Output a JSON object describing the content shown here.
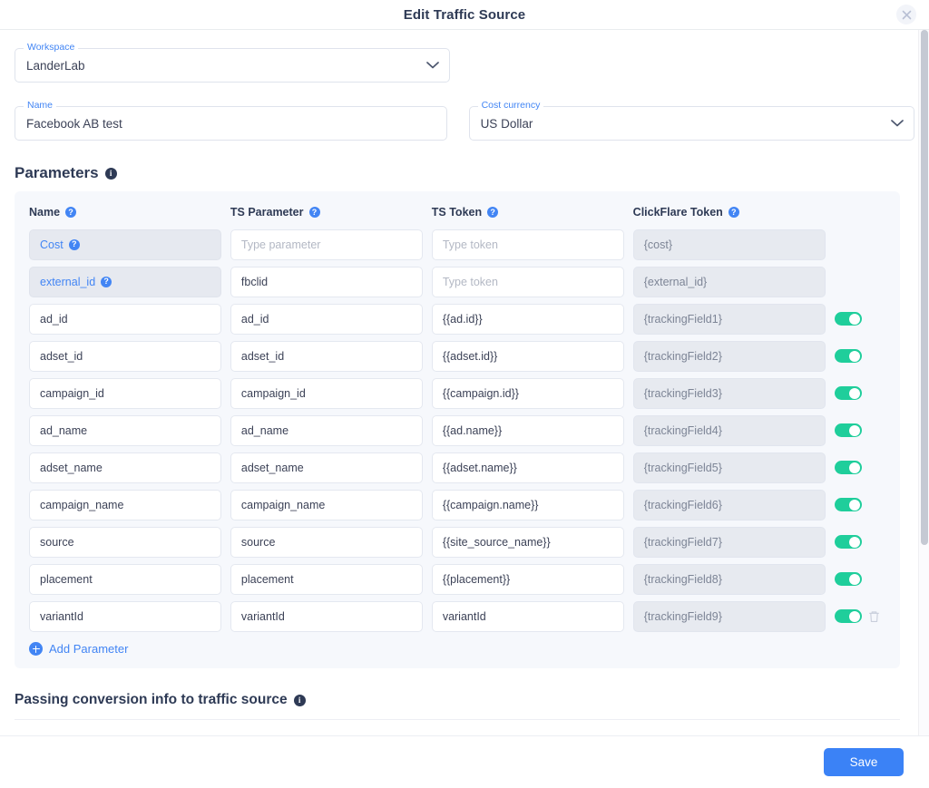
{
  "header": {
    "title": "Edit Traffic Source",
    "close_icon": "close-icon"
  },
  "form": {
    "workspace": {
      "label": "Workspace",
      "value": "LanderLab"
    },
    "name": {
      "label": "Name",
      "value": "Facebook AB test"
    },
    "cost_currency": {
      "label": "Cost currency",
      "value": "US Dollar"
    }
  },
  "parameters_section": {
    "title": "Parameters",
    "info_icon": "info-icon",
    "columns": [
      {
        "label": "Name",
        "help_icon": "help-icon"
      },
      {
        "label": "TS Parameter",
        "help_icon": "help-icon"
      },
      {
        "label": "TS Token",
        "help_icon": "help-icon"
      },
      {
        "label": "ClickFlare Token",
        "help_icon": "help-icon"
      }
    ],
    "placeholders": {
      "parameter": "Type parameter",
      "token": "Type token"
    },
    "rows": [
      {
        "name": "Cost",
        "name_locked": true,
        "name_help": true,
        "ts_parameter": "",
        "ts_parameter_placeholder": "Type parameter",
        "ts_token": "",
        "ts_token_placeholder": "Type token",
        "clickflare_token": "{cost}",
        "cf_disabled": true,
        "toggle": false,
        "toggle_on": false,
        "delete": false
      },
      {
        "name": "external_id",
        "name_locked": true,
        "name_help": true,
        "ts_parameter": "fbclid",
        "ts_parameter_placeholder": "",
        "ts_token": "",
        "ts_token_placeholder": "Type token",
        "clickflare_token": "{external_id}",
        "cf_disabled": true,
        "toggle": false,
        "toggle_on": false,
        "delete": false
      },
      {
        "name": "ad_id",
        "name_locked": false,
        "name_help": false,
        "ts_parameter": "ad_id",
        "ts_parameter_placeholder": "",
        "ts_token": "{{ad.id}}",
        "ts_token_placeholder": "",
        "clickflare_token": "{trackingField1}",
        "cf_disabled": true,
        "toggle": true,
        "toggle_on": true,
        "delete": false
      },
      {
        "name": "adset_id",
        "name_locked": false,
        "name_help": false,
        "ts_parameter": "adset_id",
        "ts_parameter_placeholder": "",
        "ts_token": "{{adset.id}}",
        "ts_token_placeholder": "",
        "clickflare_token": "{trackingField2}",
        "cf_disabled": true,
        "toggle": true,
        "toggle_on": true,
        "delete": false
      },
      {
        "name": "campaign_id",
        "name_locked": false,
        "name_help": false,
        "ts_parameter": "campaign_id",
        "ts_parameter_placeholder": "",
        "ts_token": "{{campaign.id}}",
        "ts_token_placeholder": "",
        "clickflare_token": "{trackingField3}",
        "cf_disabled": true,
        "toggle": true,
        "toggle_on": true,
        "delete": false
      },
      {
        "name": "ad_name",
        "name_locked": false,
        "name_help": false,
        "ts_parameter": "ad_name",
        "ts_parameter_placeholder": "",
        "ts_token": "{{ad.name}}",
        "ts_token_placeholder": "",
        "clickflare_token": "{trackingField4}",
        "cf_disabled": true,
        "toggle": true,
        "toggle_on": true,
        "delete": false
      },
      {
        "name": "adset_name",
        "name_locked": false,
        "name_help": false,
        "ts_parameter": "adset_name",
        "ts_parameter_placeholder": "",
        "ts_token": "{{adset.name}}",
        "ts_token_placeholder": "",
        "clickflare_token": "{trackingField5}",
        "cf_disabled": true,
        "toggle": true,
        "toggle_on": true,
        "delete": false
      },
      {
        "name": "campaign_name",
        "name_locked": false,
        "name_help": false,
        "ts_parameter": "campaign_name",
        "ts_parameter_placeholder": "",
        "ts_token": "{{campaign.name}}",
        "ts_token_placeholder": "",
        "clickflare_token": "{trackingField6}",
        "cf_disabled": true,
        "toggle": true,
        "toggle_on": true,
        "delete": false
      },
      {
        "name": "source",
        "name_locked": false,
        "name_help": false,
        "ts_parameter": "source",
        "ts_parameter_placeholder": "",
        "ts_token": "{{site_source_name}}",
        "ts_token_placeholder": "",
        "clickflare_token": "{trackingField7}",
        "cf_disabled": true,
        "toggle": true,
        "toggle_on": true,
        "delete": false
      },
      {
        "name": "placement",
        "name_locked": false,
        "name_help": false,
        "ts_parameter": "placement",
        "ts_parameter_placeholder": "",
        "ts_token": "{{placement}}",
        "ts_token_placeholder": "",
        "clickflare_token": "{trackingField8}",
        "cf_disabled": true,
        "toggle": true,
        "toggle_on": true,
        "delete": false
      },
      {
        "name": "variantId",
        "name_locked": false,
        "name_help": false,
        "ts_parameter": "variantId",
        "ts_parameter_placeholder": "",
        "ts_token": "variantId",
        "ts_token_placeholder": "",
        "clickflare_token": "{trackingField9}",
        "cf_disabled": true,
        "toggle": true,
        "toggle_on": true,
        "delete": true
      }
    ],
    "add_parameter_label": "Add Parameter"
  },
  "conversion_section": {
    "title": "Passing conversion info to traffic source",
    "info_icon": "info-icon"
  },
  "footer": {
    "save_label": "Save"
  },
  "colors": {
    "accent_blue": "#4285f4",
    "save_blue": "#3b82f6",
    "toggle_green": "#1fce9b",
    "title_dark": "#2e3a55",
    "panel_bg": "#f6f8fc"
  }
}
